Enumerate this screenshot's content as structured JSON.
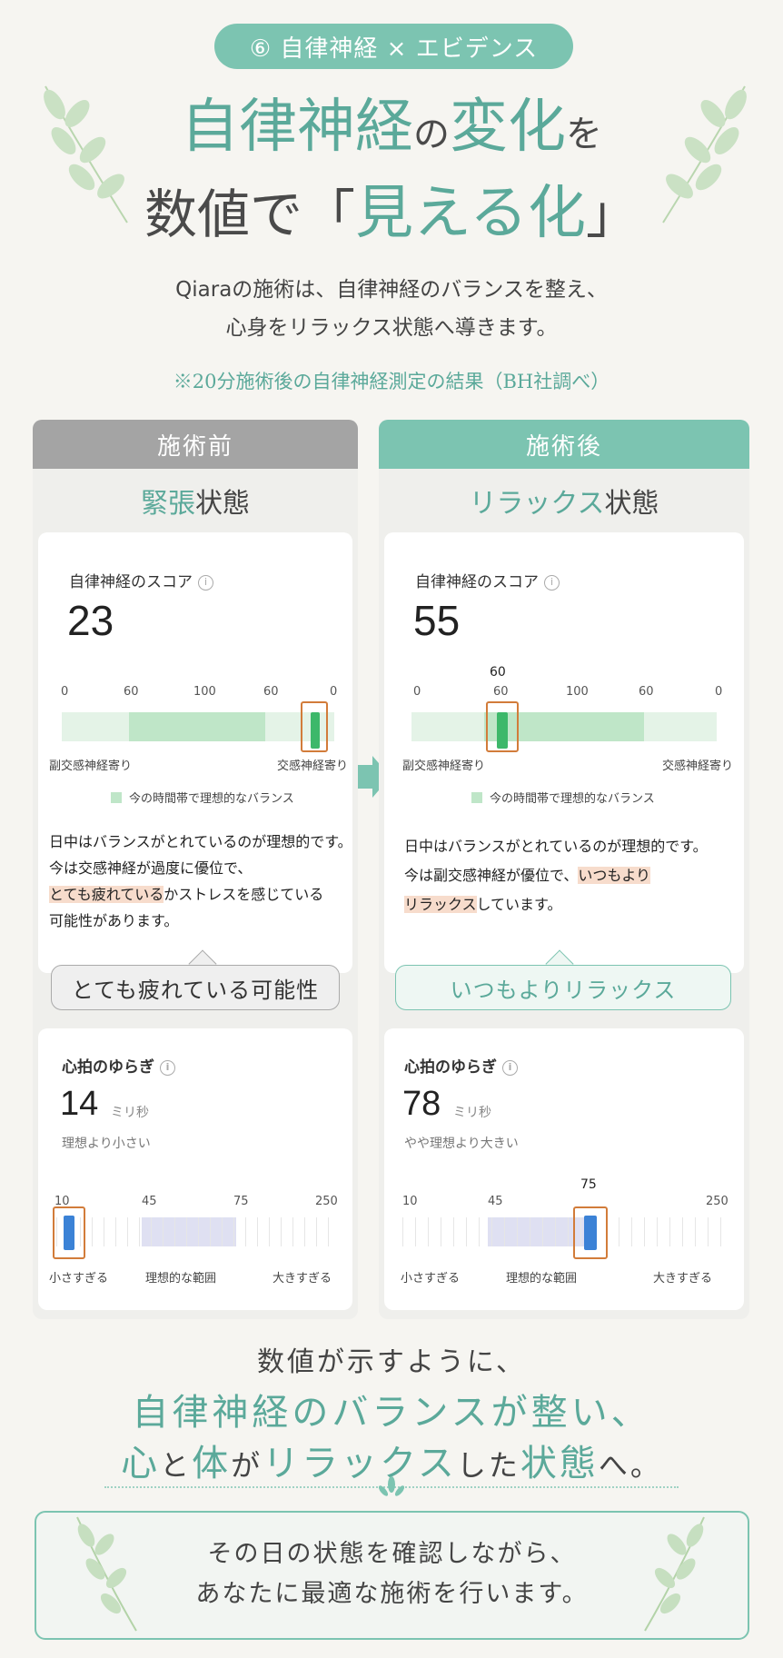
{
  "header": {
    "badge": "⑥ 自律神経 × エビデンス",
    "title_line1_a": "自律神経",
    "title_line1_b": "の",
    "title_line1_c": "変化",
    "title_line1_d": "を",
    "title_line2_a": "数値で「",
    "title_line2_b": "見える化",
    "title_line2_c": "」",
    "lead_line1": "Qiaraの施術は、自律神経のバランスを整え、",
    "lead_line2": "心身をリラックス状態へ導きます。",
    "note": "※20分施術後の自律神経測定の結果（BH社調べ）"
  },
  "before": {
    "header": "施術前",
    "state_key": "緊張",
    "state_suffix": "状態",
    "score_label": "自律神経のスコア",
    "score_value": "23",
    "score_ticks": [
      "0",
      "60",
      "100",
      "60",
      "0"
    ],
    "left_label": "副交感神経寄り",
    "right_label": "交感神経寄り",
    "legend": "今の時間帯で理想的なバランス",
    "text1": "日中はバランスがとれているのが理想的です。",
    "text2": "今は交感神経が過度に優位で、",
    "text3_hl": "とても疲れている",
    "text3_rest": "かストレスを感じている",
    "text4": "可能性があります。",
    "bubble": "とても疲れている可能性",
    "hrv_label": "心拍のゆらぎ",
    "hrv_value": "14",
    "hrv_unit": "ミリ秒",
    "hrv_desc": "理想より小さい",
    "hrv_ticks": [
      "10",
      "45",
      "75",
      "250"
    ],
    "hrv_low": "小さすぎる",
    "hrv_mid": "理想的な範囲",
    "hrv_high": "大きすぎる"
  },
  "after": {
    "header": "施術後",
    "state_key": "リラックス",
    "state_suffix": "状態",
    "score_label": "自律神経のスコア",
    "score_value": "55",
    "score_ticks": [
      "0",
      "60",
      "100",
      "60",
      "0"
    ],
    "left_label": "副交感神経寄り",
    "right_label": "交感神経寄り",
    "legend": "今の時間帯で理想的なバランス",
    "text1": "日中はバランスがとれているのが理想的です。",
    "text2_a": "今は副交感神経が優位で、",
    "text2_hl": "いつもより",
    "text3_hl": "リラックス",
    "text3_rest": "しています。",
    "bubble": "いつもよりリラックス",
    "hrv_label": "心拍のゆらぎ",
    "hrv_value": "78",
    "hrv_unit": "ミリ秒",
    "hrv_desc": "やや理想より大きい",
    "hrv_ticks": [
      "10",
      "45",
      "75",
      "250"
    ],
    "hrv_low": "小さすぎる",
    "hrv_mid": "理想的な範囲",
    "hrv_high": "大きすぎる"
  },
  "conclusion": {
    "line1": "数値が示すように、",
    "line2": "自律神経のバランスが整い、",
    "line3_a": "心",
    "line3_b": "と",
    "line3_c": "体",
    "line3_d": "が",
    "line3_e": "リラックス",
    "line3_f": "した",
    "line3_g": "状態",
    "line3_h": "へ。"
  },
  "final": {
    "line1": "その日の状態を確認しながら、",
    "line2": "あなたに最適な施術を行います。"
  },
  "colors": {
    "accent": "#7cc4b1",
    "accent_text": "#5ba99a",
    "gray_header": "#a4a4a4",
    "marker_green": "#3db86a",
    "marker_blue": "#3b82d6",
    "highlight_box": "#d27c3a"
  }
}
